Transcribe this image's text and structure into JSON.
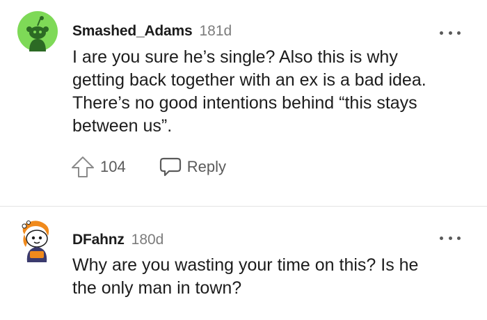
{
  "comments": [
    {
      "username": "Smashed_Adams",
      "age": "181d",
      "avatar_icon": "snoo-avatar-green",
      "body": "I are you sure he’s single? Also this is why\ngetting back together with an ex is a bad idea.\nThere’s no good intentions behind “this stays\nbetween us”.",
      "upvotes": "104",
      "reply_label": "Reply",
      "upvote_icon": "upvote-arrow-icon",
      "reply_icon": "speech-bubble-icon",
      "more_icon": "more-options-icon"
    },
    {
      "username": "DFahnz",
      "age": "180d",
      "avatar_icon": "snoo-avatar-costume",
      "body": "Why are you wasting your time on this? Is he\nthe only man in town?",
      "more_icon": "more-options-icon"
    }
  ],
  "colors": {
    "avatar_green": "#7ed957",
    "text_primary": "#1c1c1c",
    "text_secondary": "#7c7c7c",
    "icon_gray": "#5a5a5a",
    "divider": "#e3e3e3"
  }
}
